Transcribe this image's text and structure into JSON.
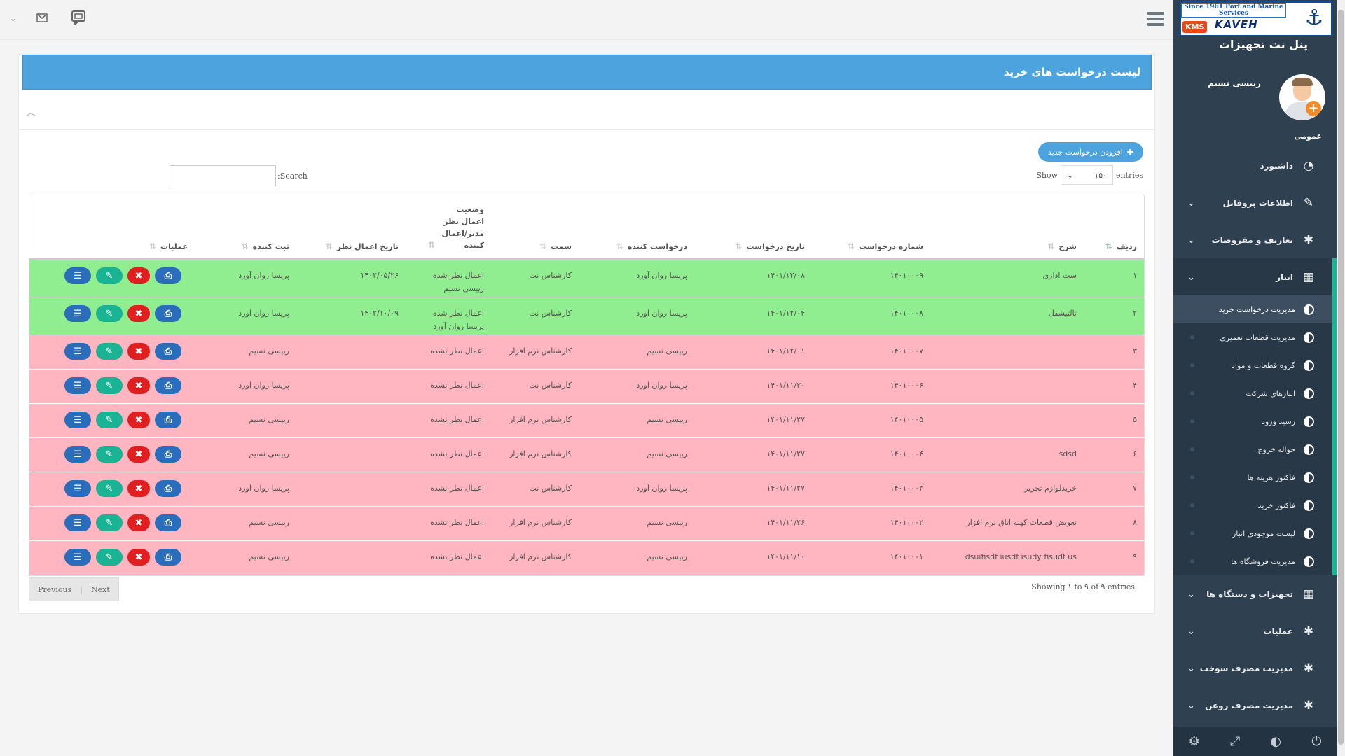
{
  "sidebar": {
    "logo": {
      "top_text": "Since 1961 Port and Marine Services",
      "name": "KAVEH",
      "kms": "KMS"
    },
    "panel_title": "پنل نت تجهیزات",
    "user_name": "رییسی نسیم",
    "section_label": "عمومی",
    "menu": [
      {
        "label": "داشبورد",
        "icon": "dashboard-icon"
      },
      {
        "label": "اطلاعات پروفایل",
        "icon": "edit-icon"
      },
      {
        "label": "تعاریف و مفروضات",
        "icon": "bug-icon"
      },
      {
        "label": "انبار",
        "icon": "table-icon"
      }
    ],
    "submenu": [
      "مدیریت درخواست خرید",
      "مدیریت قطعات تعمیری",
      "گروه قطعات و مواد",
      "انبارهای شرکت",
      "رسید ورود",
      "حواله خروج",
      "فاکتور هزینه ها",
      "فاکتور خرید",
      "لیست موجودی انبار",
      "مدیریت فروشگاه ها"
    ],
    "menu_after": [
      {
        "label": "تجهیزات و دستگاه ها",
        "icon": "table-icon"
      },
      {
        "label": "عملیات",
        "icon": "bug-icon"
      },
      {
        "label": "مدیریت مصرف سوخت",
        "icon": "bug-icon"
      },
      {
        "label": "مدیریت مصرف روغن",
        "icon": "bug-icon"
      }
    ]
  },
  "page": {
    "title": "لیست درخواست های خرید",
    "add_button": "افزودن درخواست جدید",
    "show_label": "Show",
    "entries_label": "entries",
    "page_length": "۱۵۰",
    "search_label": "Search:",
    "info": "Showing ۱ to ۹ of ۹ entries",
    "pager": {
      "next": "Next",
      "previous": "Previous"
    }
  },
  "table": {
    "headers": {
      "idx": "ردیف",
      "desc": "شرح",
      "num": "شماره درخواست",
      "date": "تاریخ درخواست",
      "req": "درخواست کننده",
      "dept": "سمت",
      "status": "وضعیت اعمال نظر مدیر/اعمال کننده",
      "adate": "تاریخ اعمال نظر",
      "reg": "ثبت کننده",
      "ops": "عملیات"
    },
    "rows": [
      {
        "idx": "۱",
        "desc": "ست اداری",
        "num": "۱۴۰۱۰۰۰۹",
        "date": "۱۴۰۱/۱۲/۰۸",
        "req": "پریسا روان آورد",
        "dept": "کارشناس نت",
        "status": "اعمال نظر شده",
        "status2": "رییسی نسیم",
        "adate": "۱۴۰۲/۰۵/۲۶",
        "reg": "پریسا روان آورد",
        "color": "green"
      },
      {
        "idx": "۲",
        "desc": "تالتیشفل",
        "num": "۱۴۰۱۰۰۰۸",
        "date": "۱۴۰۱/۱۲/۰۴",
        "req": "پریسا روان آورد",
        "dept": "کارشناس نت",
        "status": "اعمال نظر شده",
        "status2": "پریسا روان آورد",
        "adate": "۱۴۰۲/۱۰/۰۹",
        "reg": "پریسا روان آورد",
        "color": "green"
      },
      {
        "idx": "۳",
        "desc": "",
        "num": "۱۴۰۱۰۰۰۷",
        "date": "۱۴۰۱/۱۲/۰۱",
        "req": "رییسی نسیم",
        "dept": "کارشناس نرم افزار",
        "status": "اعمال نظر نشده",
        "status2": "",
        "adate": "",
        "reg": "رییسی نسیم",
        "color": "pink"
      },
      {
        "idx": "۴",
        "desc": "",
        "num": "۱۴۰۱۰۰۰۶",
        "date": "۱۴۰۱/۱۱/۳۰",
        "req": "پریسا روان آورد",
        "dept": "کارشناس نت",
        "status": "اعمال نظر نشده",
        "status2": "",
        "adate": "",
        "reg": "پریسا روان آورد",
        "color": "pink"
      },
      {
        "idx": "۵",
        "desc": "",
        "num": "۱۴۰۱۰۰۰۵",
        "date": "۱۴۰۱/۱۱/۲۷",
        "req": "رییسی نسیم",
        "dept": "کارشناس نرم افزار",
        "status": "اعمال نظر نشده",
        "status2": "",
        "adate": "",
        "reg": "رییسی نسیم",
        "color": "pink"
      },
      {
        "idx": "۶",
        "desc": "sdsd",
        "num": "۱۴۰۱۰۰۰۴",
        "date": "۱۴۰۱/۱۱/۲۷",
        "req": "رییسی نسیم",
        "dept": "کارشناس نرم افزار",
        "status": "اعمال نظر نشده",
        "status2": "",
        "adate": "",
        "reg": "رییسی نسیم",
        "color": "pink"
      },
      {
        "idx": "۷",
        "desc": "خریدلوازم تحریر",
        "num": "۱۴۰۱۰۰۰۳",
        "date": "۱۴۰۱/۱۱/۲۷",
        "req": "پریسا روان آورد",
        "dept": "کارشناس نت",
        "status": "اعمال نظر نشده",
        "status2": "",
        "adate": "",
        "reg": "پریسا روان آورد",
        "color": "pink"
      },
      {
        "idx": "۸",
        "desc": "تعویض قطعات کهنه اتاق نرم افزار",
        "num": "۱۴۰۱۰۰۰۲",
        "date": "۱۴۰۱/۱۱/۲۶",
        "req": "رییسی نسیم",
        "dept": "کارشناس نرم افزار",
        "status": "اعمال نظر نشده",
        "status2": "",
        "adate": "",
        "reg": "رییسی نسیم",
        "color": "pink"
      },
      {
        "idx": "۹",
        "desc": "dsuifisdf iusdf isudy fisudf us",
        "num": "۱۴۰۱۰۰۰۱",
        "date": "۱۴۰۱/۱۱/۱۰",
        "req": "رییسی نسیم",
        "dept": "کارشناس نرم افزار",
        "status": "اعمال نظر نشده",
        "status2": "",
        "adate": "",
        "reg": "رییسی نسیم",
        "color": "pink"
      }
    ]
  },
  "colors": {
    "header_blue": "#4da3de",
    "sidebar": "#2f4050",
    "accent": "#1ab394",
    "row_green": "#90ee90",
    "row_pink": "#ffb6c1"
  }
}
